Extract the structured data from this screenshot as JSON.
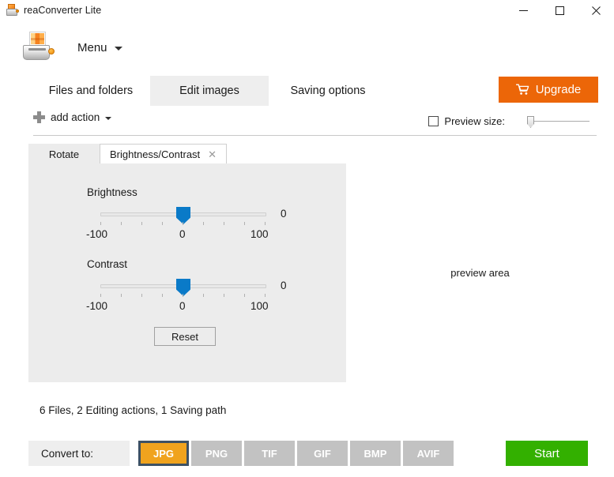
{
  "window": {
    "title": "reaConverter Lite",
    "icon": "app-printer-icon",
    "controls": {
      "minimize": "–",
      "maximize": "□",
      "close": "✕"
    }
  },
  "header": {
    "menu_label": "Menu",
    "app_icon": "app-printer-icon"
  },
  "main_tabs": [
    {
      "id": "files",
      "label": "Files and folders",
      "active": false
    },
    {
      "id": "edit",
      "label": "Edit images",
      "active": true
    },
    {
      "id": "saving",
      "label": "Saving options",
      "active": false
    }
  ],
  "upgrade": {
    "label": "Upgrade",
    "icon": "shopping-cart-icon",
    "color": "#ec6608"
  },
  "action_row": {
    "add_action_label": "add action",
    "plus_icon": "plus-icon",
    "preview_size_label": "Preview size:",
    "preview_size_checked": false,
    "preview_slider_value": 0
  },
  "sub_tabs": [
    {
      "id": "rotate",
      "label": "Rotate",
      "active": false,
      "closable": false
    },
    {
      "id": "brightness-contrast",
      "label": "Brightness/Contrast",
      "active": true,
      "closable": true,
      "close_glyph": "✕"
    }
  ],
  "edit_panel": {
    "brightness": {
      "label": "Brightness",
      "value": "0",
      "min_label": "-100",
      "mid_label": "0",
      "max_label": "100",
      "min": -100,
      "max": 100
    },
    "contrast": {
      "label": "Contrast",
      "value": "0",
      "min_label": "-100",
      "mid_label": "0",
      "max_label": "100",
      "min": -100,
      "max": 100
    },
    "reset_label": "Reset"
  },
  "preview": {
    "placeholder_text": "preview area"
  },
  "summary": {
    "text": "6 Files, 2 Editing actions, 1 Saving path"
  },
  "bottom": {
    "convert_to_label": "Convert to:",
    "formats": [
      {
        "id": "jpg",
        "label": "JPG",
        "selected": true
      },
      {
        "id": "png",
        "label": "PNG",
        "selected": false
      },
      {
        "id": "tif",
        "label": "TIF",
        "selected": false
      },
      {
        "id": "gif",
        "label": "GIF",
        "selected": false
      },
      {
        "id": "bmp",
        "label": "BMP",
        "selected": false
      },
      {
        "id": "avif",
        "label": "AVIF",
        "selected": false
      }
    ],
    "start_label": "Start",
    "start_color": "#33b000",
    "selected_format_color": "#f0a31e",
    "selected_format_border": "#3d5164"
  }
}
